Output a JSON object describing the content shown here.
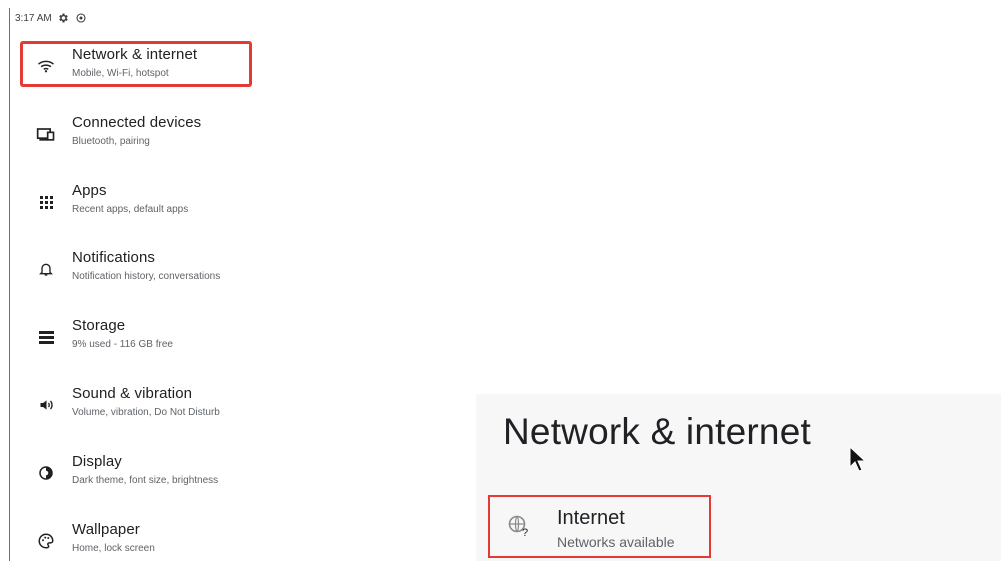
{
  "status_bar": {
    "time": "3:17 AM",
    "icons": [
      "settings-gear-icon",
      "sync-icon"
    ]
  },
  "settings": {
    "items": [
      {
        "title": "Network & internet",
        "subtitle": "Mobile, Wi-Fi, hotspot",
        "icon": "wifi-icon",
        "highlighted": true
      },
      {
        "title": "Connected devices",
        "subtitle": "Bluetooth, pairing",
        "icon": "devices-icon"
      },
      {
        "title": "Apps",
        "subtitle": "Recent apps, default apps",
        "icon": "apps-grid-icon"
      },
      {
        "title": "Notifications",
        "subtitle": "Notification history, conversations",
        "icon": "bell-icon"
      },
      {
        "title": "Storage",
        "subtitle": "9% used - 116 GB free",
        "icon": "storage-icon"
      },
      {
        "title": "Sound & vibration",
        "subtitle": "Volume, vibration, Do Not Disturb",
        "icon": "volume-icon"
      },
      {
        "title": "Display",
        "subtitle": "Dark theme, font size, brightness",
        "icon": "display-icon"
      },
      {
        "title": "Wallpaper",
        "subtitle": "Home, lock screen",
        "icon": "palette-icon"
      }
    ]
  },
  "network_page": {
    "title": "Network & internet",
    "internet": {
      "title": "Internet",
      "subtitle": "Networks available",
      "icon": "globe-question-icon"
    }
  },
  "colors": {
    "highlight": "#e53935",
    "text_primary": "#202124",
    "text_secondary": "#5f6368"
  }
}
